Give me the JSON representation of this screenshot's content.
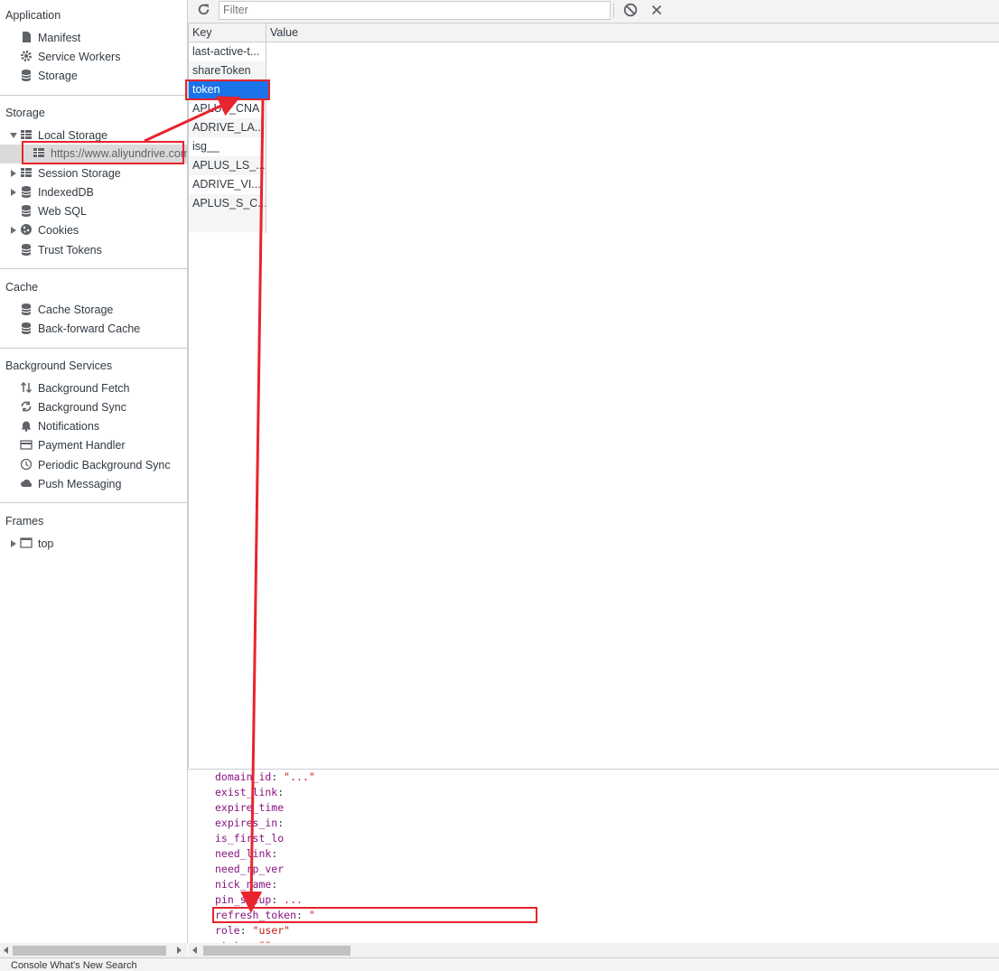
{
  "sidebar": {
    "application": {
      "title": "Application",
      "items": [
        {
          "label": "Manifest",
          "icon": "file-icon"
        },
        {
          "label": "Service Workers",
          "icon": "gear-icon"
        },
        {
          "label": "Storage",
          "icon": "database-icon"
        }
      ]
    },
    "storage": {
      "title": "Storage",
      "local_storage": "Local Storage",
      "local_origin": "https://www.aliyundrive.com",
      "items": [
        {
          "label": "Session Storage",
          "icon": "table-icon"
        },
        {
          "label": "IndexedDB",
          "icon": "database-icon"
        },
        {
          "label": "Web SQL",
          "icon": "database-icon"
        },
        {
          "label": "Cookies",
          "icon": "cookie-icon"
        },
        {
          "label": "Trust Tokens",
          "icon": "database-icon"
        }
      ]
    },
    "cache": {
      "title": "Cache",
      "items": [
        {
          "label": "Cache Storage",
          "icon": "database-icon"
        },
        {
          "label": "Back-forward Cache",
          "icon": "database-icon"
        }
      ]
    },
    "background": {
      "title": "Background Services",
      "items": [
        {
          "label": "Background Fetch",
          "icon": "up-down-arrows-icon"
        },
        {
          "label": "Background Sync",
          "icon": "sync-icon"
        },
        {
          "label": "Notifications",
          "icon": "bell-icon"
        },
        {
          "label": "Payment Handler",
          "icon": "card-icon"
        },
        {
          "label": "Periodic Background Sync",
          "icon": "clock-icon"
        },
        {
          "label": "Push Messaging",
          "icon": "cloud-icon"
        }
      ]
    },
    "frames": {
      "title": "Frames",
      "items": [
        {
          "label": "top",
          "icon": "frame-icon"
        }
      ]
    }
  },
  "toolbar": {
    "filter_placeholder": "Filter"
  },
  "grid": {
    "headers": {
      "key": "Key",
      "value": "Value"
    },
    "rows": [
      "last-active-t...",
      "shareToken",
      "token",
      "APLUS_CNA",
      "ADRIVE_LA...",
      "isg__",
      "APLUS_LS_...",
      "ADRIVE_VI...",
      "APLUS_S_C..."
    ],
    "selected": "token"
  },
  "preview": {
    "lines": [
      {
        "k": "domain_id",
        "v": "\"...\""
      },
      {
        "k": "exist_link",
        "v": ""
      },
      {
        "k": "expire_time",
        "v": ""
      },
      {
        "k": "expires_in",
        "v": ""
      },
      {
        "k": "is_first_lo",
        "v": ""
      },
      {
        "k": "need_link",
        "v": ""
      },
      {
        "k": "need_rp_ver",
        "v": ""
      },
      {
        "k": "nick_name",
        "v": ""
      },
      {
        "k": "pin_setup",
        "v": "..."
      },
      {
        "k": "refresh_token",
        "v": "\""
      },
      {
        "k": "role",
        "v": "\"user\""
      },
      {
        "k": "state",
        "v": "\"\""
      }
    ]
  },
  "bottom": {
    "tabs": "Console   What's New   Search"
  },
  "colors": {
    "annotation": "#e8242c",
    "selection": "#1a73e8"
  }
}
